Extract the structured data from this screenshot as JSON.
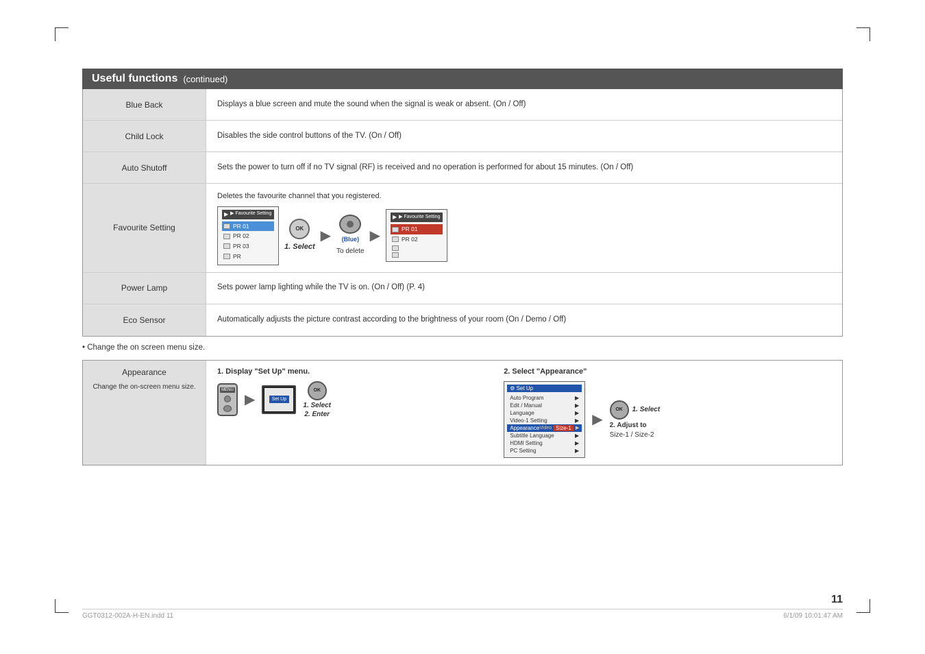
{
  "page": {
    "number": "11",
    "footer_left": "GGT0312-002A-H-EN.indd   11",
    "footer_right": "6/1/09   10:01:47 AM"
  },
  "header": {
    "title_bold": "Useful functions",
    "title_suffix": "(continued)"
  },
  "note_change": "• Change the on screen menu size.",
  "features": [
    {
      "label": "Blue Back",
      "description": "Displays a blue screen and mute the sound when the signal is weak or absent. (On / Off)"
    },
    {
      "label": "Child Lock",
      "description": "Disables the side control buttons of the TV. (On / Off)"
    },
    {
      "label": "Auto Shutoff",
      "description": "Sets the power to turn off if no TV signal (RF) is received and no operation is performed for about 15 minutes. (On / Off)"
    },
    {
      "label": "Favourite Setting",
      "description": "Deletes the favourite channel that you registered."
    },
    {
      "label": "Power Lamp",
      "description": "Sets power lamp lighting while the TV is on. (On / Off) (P. 4)"
    },
    {
      "label": "Eco Sensor",
      "description": "Automatically adjusts the picture contrast according to the brightness of your room (On / Demo / Off)"
    }
  ],
  "favourite": {
    "desc": "Deletes the favourite channel that you registered.",
    "step1_label": "1. Select",
    "blue_label": "(Blue)",
    "to_delete": "To delete",
    "mini_screen_title": "▶ Favourite Setting",
    "channels": [
      "PR 01",
      "PR 02",
      "PR 03",
      "PR"
    ],
    "blue_indicator": "B"
  },
  "appearance": {
    "label": "Appearance",
    "sub_label": "Change the on-screen menu size.",
    "step1_display": "1. Display \"Set Up\" menu.",
    "step2_select": "2. Select \"Appearance\"",
    "step1_select": "1. Select",
    "step2_enter": "2. Enter",
    "step1_select2": "1. Select",
    "adjust": "2. Adjust to",
    "size_options": "Size-1 / Size-2",
    "menu_title": "Set Up",
    "menu_items": [
      {
        "name": "Auto Program",
        "value": ""
      },
      {
        "name": "Edit / Manual",
        "value": ""
      },
      {
        "name": "Language",
        "value": ""
      },
      {
        "name": "Video-1 Setting",
        "value": ""
      },
      {
        "name": "Appearance",
        "value": "Video",
        "highlighted": true,
        "subval": "Size-1"
      },
      {
        "name": "Subtitle Language",
        "value": ""
      },
      {
        "name": "HDMI Setting",
        "value": ""
      },
      {
        "name": "PC Setting",
        "value": ""
      }
    ]
  },
  "icons": {
    "arrow_right": "▶",
    "step": "1.",
    "ok": "OK",
    "menu": "MENU"
  }
}
